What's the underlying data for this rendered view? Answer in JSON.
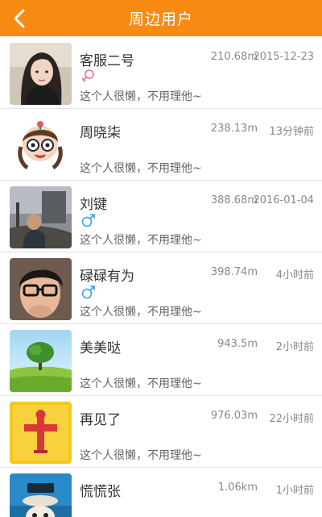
{
  "header": {
    "title": "周边用户",
    "background": "#f98b13"
  },
  "users": [
    {
      "name": "客服二号",
      "distance": "210.68m",
      "time": "2015-12-23",
      "gender": "female",
      "gender_icon": "female-symbol-icon",
      "bio": "这个人很懒，不用理他~",
      "avatar": "woman-portrait"
    },
    {
      "name": "周晓柒",
      "distance": "238.13m",
      "time": "13分钟前",
      "gender": "",
      "gender_icon": "",
      "bio": "这个人很懒，不用理他~",
      "avatar": "cartoon-girl-with-glasses"
    },
    {
      "name": "刘键",
      "distance": "388.68m",
      "time": "2016-01-04",
      "gender": "male",
      "gender_icon": "male-symbol-icon",
      "bio": "这个人很懒，不用理他~",
      "avatar": "man-outdoors-photo"
    },
    {
      "name": "碌碌有为",
      "distance": "398.74m",
      "time": "4小时前",
      "gender": "male",
      "gender_icon": "male-symbol-icon",
      "bio": "这个人很懒，不用理他~",
      "avatar": "man-with-glasses"
    },
    {
      "name": "美美哒",
      "distance": "943.5m",
      "time": "2小时前",
      "gender": "",
      "gender_icon": "",
      "bio": "这个人很懒，不用理他~",
      "avatar": "tree-on-grass"
    },
    {
      "name": "再见了",
      "distance": "976.03m",
      "time": "22小时前",
      "gender": "",
      "gender_icon": "",
      "bio": "这个人很懒，不用理他~",
      "avatar": "yellow-scarecrow-art"
    },
    {
      "name": "慌慌张",
      "distance": "1.06km",
      "time": "1小时前",
      "gender": "",
      "gender_icon": "",
      "bio": "",
      "avatar": "cartoon-character-blue"
    }
  ],
  "colors": {
    "female": "#f06aa0",
    "male": "#3aa0e8",
    "text": "#333333",
    "meta": "#888888"
  }
}
